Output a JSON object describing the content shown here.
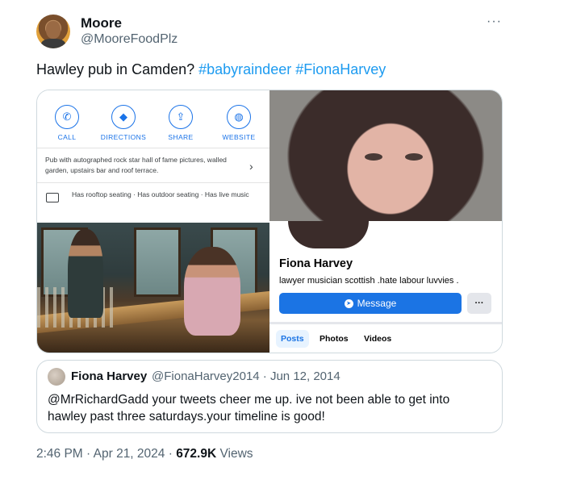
{
  "author": {
    "display_name": "Moore",
    "handle": "@MooreFoodPlz",
    "more_label": "···"
  },
  "tweet": {
    "text_prefix": "Hawley pub in Camden? ",
    "hashtag_1": "#babyraindeer",
    "hashtag_2": "#FionaHarvey"
  },
  "maps_card": {
    "actions": [
      {
        "label": "CALL",
        "icon": "phone-icon",
        "glyph": "✆"
      },
      {
        "label": "DIRECTIONS",
        "icon": "directions-icon",
        "glyph": "◆"
      },
      {
        "label": "SHARE",
        "icon": "share-icon",
        "glyph": "⇪"
      },
      {
        "label": "WEBSITE",
        "icon": "globe-icon",
        "glyph": "◍"
      }
    ],
    "description": "Pub with autographed rock star hall of fame pictures, walled garden, upstairs bar and roof terrace.",
    "features": "Has rooftop seating · Has outdoor seating · Has live music",
    "accent": "#1a73e8"
  },
  "facebook": {
    "name": "Fiona Harvey",
    "bio": "lawyer  musician  scottish   .hate labour luvvies .",
    "message_label": "Message",
    "more_label": "···",
    "tabs": [
      "Posts",
      "Photos",
      "Videos"
    ],
    "button_color": "#1b74e4"
  },
  "quote": {
    "display_name": "Fiona Harvey",
    "meta": "@FionaHarvey2014 · Jun 12, 2014",
    "text": "@MrRichardGadd your tweets cheer me up. ive not been able to get into hawley past three saturdays.your timeline is good!"
  },
  "footer": {
    "time_date": "2:46 PM · Apr 21, 2024 · ",
    "views_count": "672.9K",
    "views_label": " Views"
  },
  "colors": {
    "link": "#1d9bf0",
    "secondary_text": "#536471"
  }
}
